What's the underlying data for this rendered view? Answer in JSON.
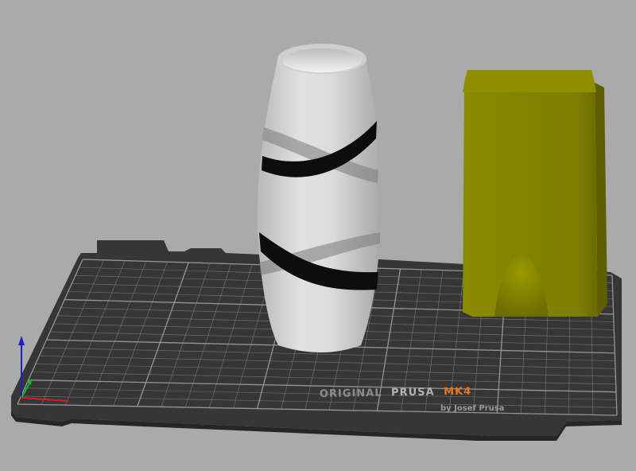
{
  "viewport": {
    "background_color": "#aaaaaa"
  },
  "bed": {
    "color": "#363636",
    "grid_color": "#9a9a9a",
    "brand": {
      "word1": "ORIGINAL",
      "word2": "PRUSA",
      "word3": "MK4",
      "byline": "by Josef Prusa",
      "accent_color": "#e8761d",
      "text_color": "#8c8c8c"
    }
  },
  "objects": [
    {
      "name": "vase",
      "color": "#d2d2d2",
      "stripe_color": "#0d0d0d"
    },
    {
      "name": "block",
      "color": "#7f7f00"
    }
  ],
  "axes": {
    "x_color": "#d62020",
    "y_color": "#20b020",
    "z_color": "#1e1ec8"
  }
}
